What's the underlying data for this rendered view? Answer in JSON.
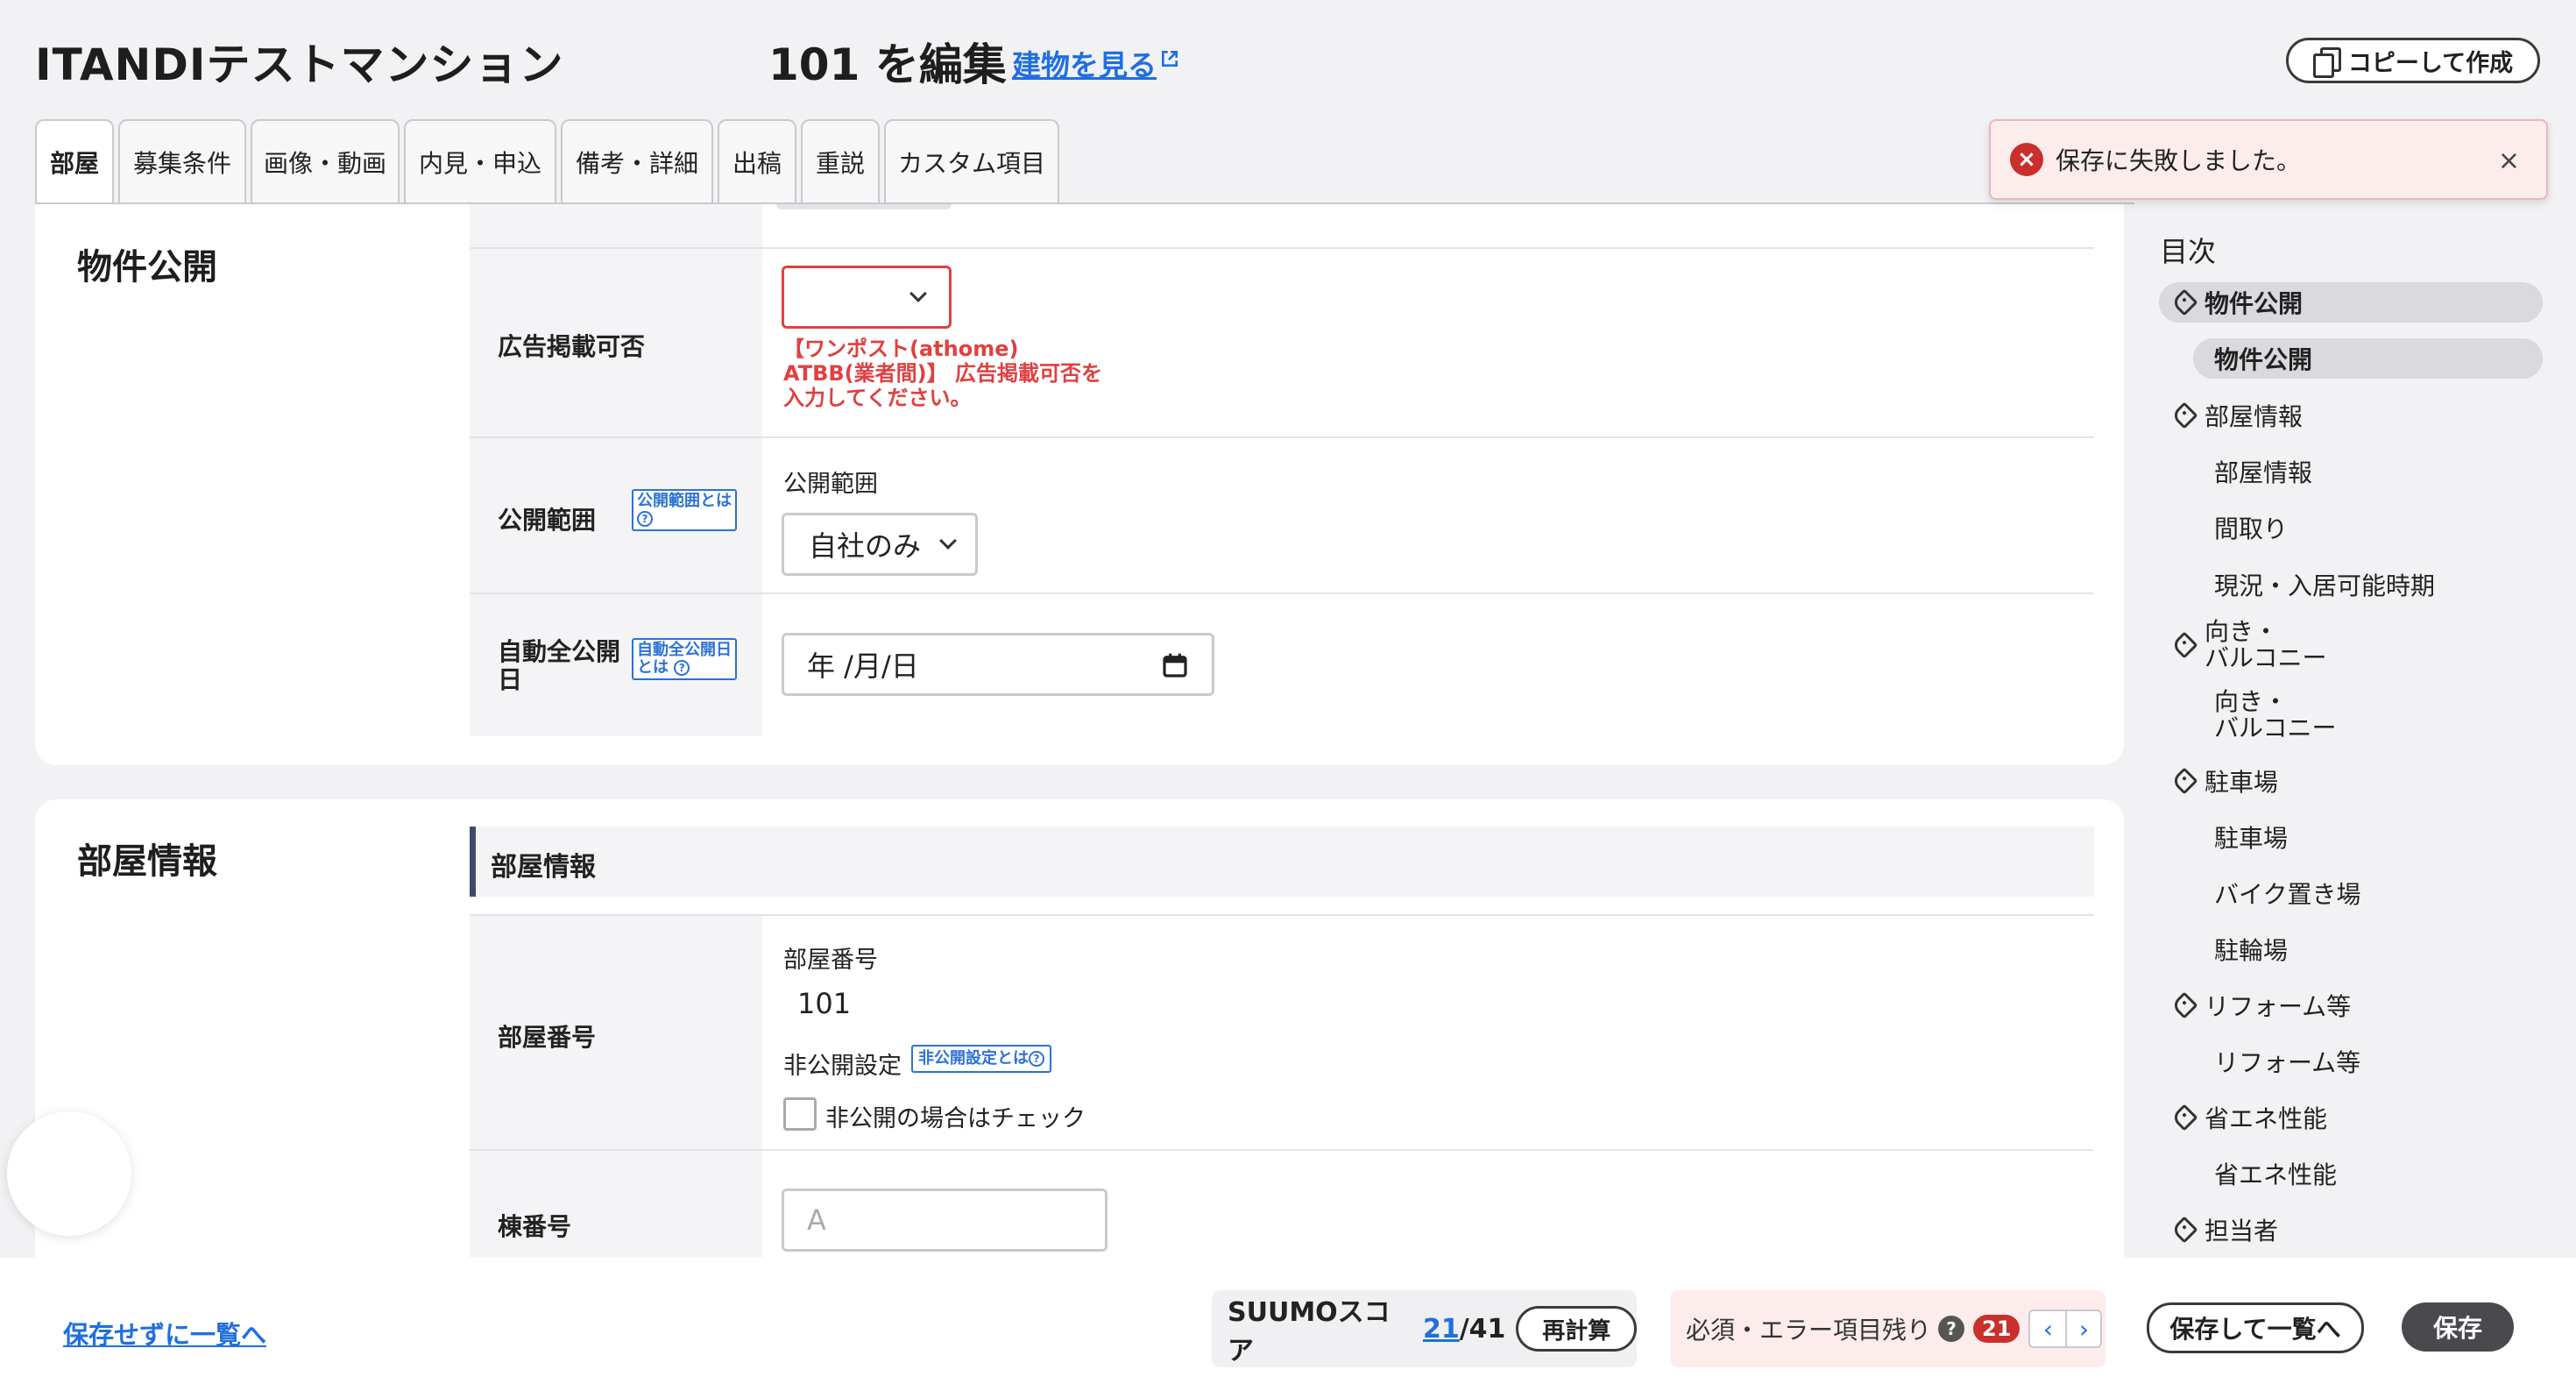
{
  "header": {
    "building_name": "ITANDIテストマンション",
    "edit_title": "101 を編集",
    "view_building_link": "建物を見る",
    "copy_button": "コピーして作成"
  },
  "tabs": [
    {
      "label": "部屋",
      "active": true
    },
    {
      "label": "募集条件"
    },
    {
      "label": "画像・動画"
    },
    {
      "label": "内見・申込"
    },
    {
      "label": "備考・詳細"
    },
    {
      "label": "出稿"
    },
    {
      "label": "重説"
    },
    {
      "label": "カスタム項目"
    }
  ],
  "toast": {
    "message": "保存に失敗しました。",
    "close": "×"
  },
  "section_publish": {
    "title": "物件公開",
    "ad_permission": {
      "label": "広告掲載可否",
      "value": "",
      "error_lines": [
        "【ワンポスト(athome)",
        "ATBB(業者間)】 広告掲載可否を",
        "入力してください。"
      ]
    },
    "scope": {
      "label": "公開範囲",
      "help": "公開範囲とは",
      "caption": "公開範囲",
      "value": "自社のみ"
    },
    "auto_publish": {
      "label": "自動全公開日",
      "help": "自動全公開日とは",
      "placeholder": "年 /月/日"
    }
  },
  "section_room": {
    "title": "部屋情報",
    "subheader": "部屋情報",
    "room_number": {
      "label": "部屋番号",
      "caption": "部屋番号",
      "value": "101",
      "private_caption": "非公開設定",
      "private_help": "非公開設定とは",
      "private_checkbox": "非公開の場合はチェック"
    },
    "building_number": {
      "label": "棟番号",
      "placeholder": "A"
    }
  },
  "toc": {
    "title": "目次",
    "items": [
      {
        "label": "物件公開",
        "level": 1,
        "selected": true
      },
      {
        "label": "物件公開",
        "level": 2,
        "selected": true
      },
      {
        "label": "部屋情報",
        "level": 1
      },
      {
        "label": "部屋情報",
        "level": 2
      },
      {
        "label": "間取り",
        "level": 2
      },
      {
        "label": "現況・入居可能時期",
        "level": 2
      },
      {
        "label": "向き・\nバルコニー",
        "level": 1
      },
      {
        "label": "向き・\nバルコニー",
        "level": 2
      },
      {
        "label": "駐車場",
        "level": 1
      },
      {
        "label": "駐車場",
        "level": 2
      },
      {
        "label": "バイク置き場",
        "level": 2
      },
      {
        "label": "駐輪場",
        "level": 2
      },
      {
        "label": "リフォーム等",
        "level": 1
      },
      {
        "label": "リフォーム等",
        "level": 2
      },
      {
        "label": "省エネ性能",
        "level": 1
      },
      {
        "label": "省エネ性能",
        "level": 2
      },
      {
        "label": "担当者",
        "level": 1
      }
    ]
  },
  "footer": {
    "back_link": "保存せずに一覧へ",
    "suumo_label": "SUUMOスコア",
    "suumo_score": "21",
    "suumo_total": "/41",
    "recalc": "再計算",
    "required_label": "必須・エラー項目残り",
    "required_count": "21",
    "save_and_list": "保存して一覧へ",
    "save": "保存"
  }
}
